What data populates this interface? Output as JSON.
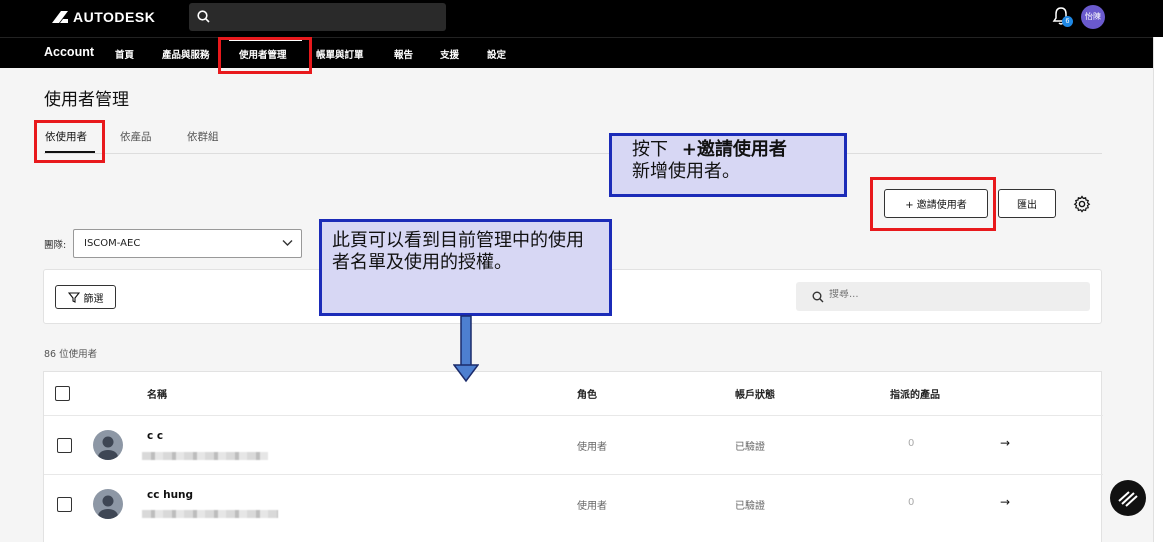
{
  "brand": {
    "name": "AUTODESK"
  },
  "topbar": {
    "search_placeholder": "",
    "notification_count": "6",
    "user_initials": "怡陳",
    "icons": [
      "search-icon",
      "bell-icon"
    ]
  },
  "nav": {
    "account": "Account",
    "items": [
      "首頁",
      "產品與服務",
      "使用者管理",
      "帳單與訂單",
      "報告",
      "支援",
      "設定"
    ],
    "active": "使用者管理"
  },
  "page": {
    "title": "使用者管理",
    "tabs": [
      "依使用者",
      "依產品",
      "依群組"
    ],
    "active_tab": "依使用者"
  },
  "actions": {
    "invite_label": "+ 邀請使用者",
    "export_label": "匯出"
  },
  "team": {
    "label": "團隊:",
    "value": "ISCOM-AEC"
  },
  "filter": {
    "filter_label": "篩選",
    "search_placeholder": "搜尋..."
  },
  "user_count": "86 位使用者",
  "table": {
    "headers": [
      "名稱",
      "角色",
      "帳戶狀態",
      "指派的產品"
    ],
    "rows": [
      {
        "name": "c c",
        "role": "使用者",
        "status": "已驗證",
        "products": "0"
      },
      {
        "name": "cc hung",
        "role": "使用者",
        "status": "已驗證",
        "products": "0"
      }
    ]
  },
  "annotations": {
    "invite_note_bold": "+邀請使用者",
    "invite_note_prefix": "按下",
    "invite_note_line2": "新增使用者。",
    "list_note": "此頁可以看到目前管理中的使用者名單及使用的授權。"
  },
  "colors": {
    "highlight_red": "#e8191c",
    "callout_border": "#1b2bb8",
    "callout_fill": "#d7d7f4",
    "avatar_purple": "#6a5acd"
  }
}
